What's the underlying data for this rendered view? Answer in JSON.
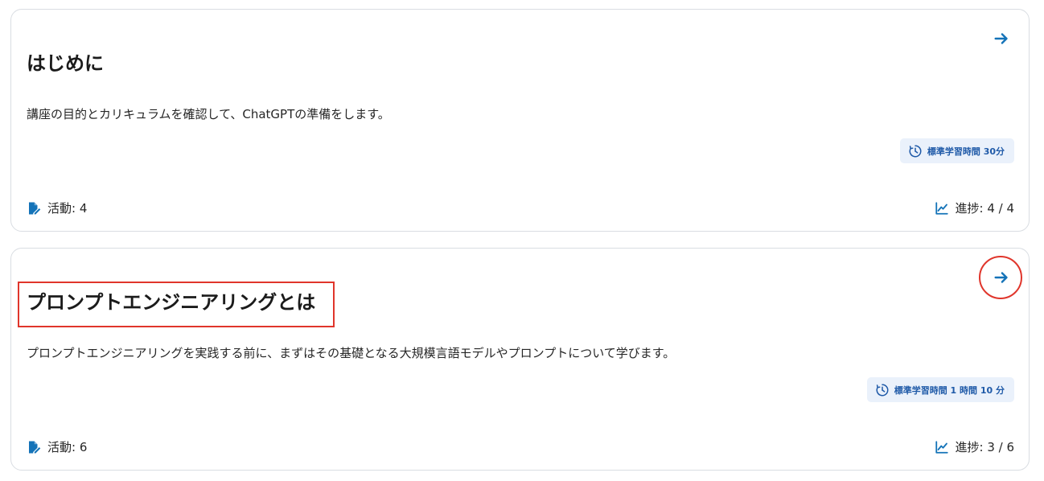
{
  "colors": {
    "accent": "#1473b8",
    "badge_bg": "#eaf1fb",
    "badge_text": "#1f5aa8",
    "highlight": "#e0352b"
  },
  "sections": [
    {
      "title": "はじめに",
      "description": "講座の目的とカリキュラムを確認して、ChatGPTの準備をします。",
      "time_label": "標準学習時間 30分",
      "activities_label": "活動: 4",
      "progress_label": "進捗: 4 / 4",
      "icons": {
        "open": "arrow-right-icon",
        "time": "clock-icon",
        "activities": "file-pen-icon",
        "progress": "chart-line-icon"
      }
    },
    {
      "title": "プロンプトエンジニアリングとは",
      "description": "プロンプトエンジニアリングを実践する前に、まずはその基礎となる大規模言語モデルやプロンプトについて学びます。",
      "time_label": "標準学習時間 1 時間 10 分",
      "activities_label": "活動: 6",
      "progress_label": "進捗: 3 / 6",
      "icons": {
        "open": "arrow-right-icon",
        "time": "clock-icon",
        "activities": "file-pen-icon",
        "progress": "chart-line-icon"
      }
    }
  ]
}
